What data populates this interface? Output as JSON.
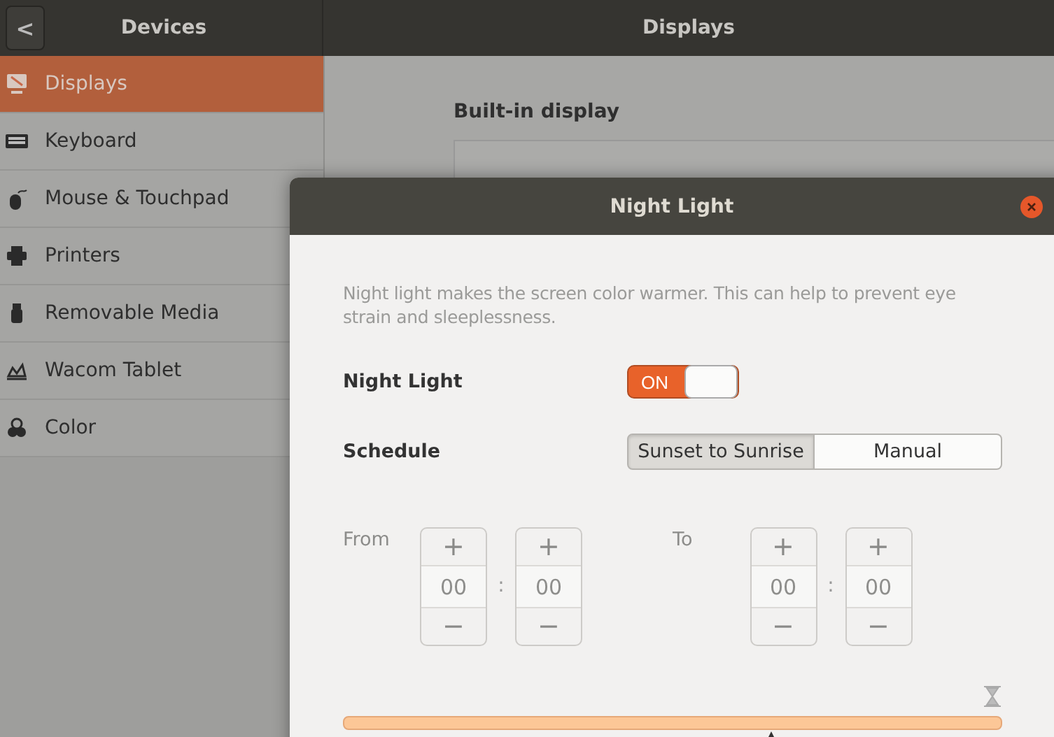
{
  "header": {
    "back_button": "<",
    "title": "Devices",
    "page_title": "Displays"
  },
  "sidebar": {
    "items": [
      {
        "label": "Displays",
        "selected": true
      },
      {
        "label": "Keyboard",
        "selected": false
      },
      {
        "label": "Mouse & Touchpad",
        "selected": false
      },
      {
        "label": "Printers",
        "selected": false
      },
      {
        "label": "Removable Media",
        "selected": false
      },
      {
        "label": "Wacom Tablet",
        "selected": false
      },
      {
        "label": "Color",
        "selected": false
      }
    ]
  },
  "content": {
    "section_title": "Built-in display"
  },
  "dialog": {
    "title": "Night Light",
    "description": "Night light makes the screen color warmer. This can help to prevent eye strain and sleeplessness.",
    "night_light": {
      "label": "Night Light",
      "on": true,
      "on_text": "ON"
    },
    "schedule": {
      "label": "Schedule",
      "options": [
        {
          "label": "Sunset to Sunrise",
          "selected": true
        },
        {
          "label": "Manual",
          "selected": false
        }
      ]
    },
    "times": [
      {
        "label": "From",
        "hours": "00",
        "minutes": "00",
        "separator": ":",
        "plus": "+",
        "minus": "−"
      },
      {
        "label": "To",
        "hours": "00",
        "minutes": "00",
        "separator": ":",
        "plus": "+",
        "minus": "−"
      }
    ],
    "temperature": {
      "level": 0.65
    }
  }
}
